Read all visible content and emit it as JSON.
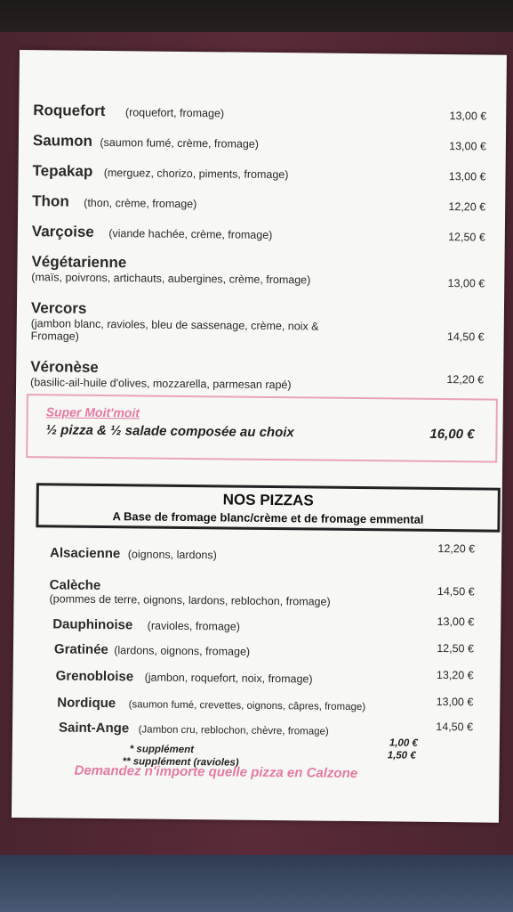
{
  "menu_top": [
    {
      "name": "Roquefort",
      "desc": "(roquefort, fromage)",
      "price": "13,00 €"
    },
    {
      "name": "Saumon",
      "desc": "(saumon fumé, crème, fromage)",
      "price": "13,00 €"
    },
    {
      "name": "Tepakap",
      "desc": "(merguez, chorizo, piments, fromage)",
      "price": "13,00 €"
    },
    {
      "name": "Thon",
      "desc": "(thon, crème, fromage)",
      "price": "12,20 €"
    },
    {
      "name": "Varçoise",
      "desc": "(viande hachée, crème, fromage)",
      "price": "12,50 €"
    },
    {
      "name": "Végétarienne",
      "desc": "(maïs, poivrons, artichauts, aubergines, crème, fromage)",
      "price": "13,00 €"
    },
    {
      "name": "Vercors",
      "desc": "(jambon blanc, ravioles, bleu de sassenage, crème, noix & Fromage)",
      "price": "14,50 €"
    },
    {
      "name": "Véronèse",
      "desc": "(basilic-ail-huile d'olives, mozzarella, parmesan rapé)",
      "price": "12,20 €"
    }
  ],
  "promo": {
    "title": "Super Moit'moit",
    "line": "½ pizza & ½ salade composée au choix",
    "price": "16,00 €"
  },
  "section": {
    "title": "NOS PIZZAS",
    "subtitle": "A Base de fromage blanc/crème et de fromage emmental"
  },
  "menu_bottom": [
    {
      "name": "Alsacienne",
      "desc": "(oignons, lardons)",
      "price": "12,20 €"
    },
    {
      "name": "Calèche",
      "desc": "(pommes de terre, oignons, lardons, reblochon, fromage)",
      "price": "14,50 €"
    },
    {
      "name": "Dauphinoise",
      "desc": "(ravioles, fromage)",
      "price": "13,00 €"
    },
    {
      "name": "Gratinée",
      "desc": "(lardons, oignons, fromage)",
      "price": "12,50 €"
    },
    {
      "name": "Grenobloise",
      "desc": "(jambon, roquefort, noix, fromage)",
      "price": "13,20 €"
    },
    {
      "name": "Nordique",
      "desc": "(saumon fumé, crevettes, oignons, câpres, fromage)",
      "price": "13,00 €"
    },
    {
      "name": "Saint-Ange",
      "desc": "(Jambon cru, reblochon, chèvre, fromage)",
      "price": "14,50 €"
    }
  ],
  "supplements": [
    {
      "label": "* supplément",
      "price": "1,00 €"
    },
    {
      "label": "** supplément (ravioles)",
      "price": "1,50 €"
    }
  ],
  "calzone": "Demandez n'importe quelle pizza en Calzone"
}
